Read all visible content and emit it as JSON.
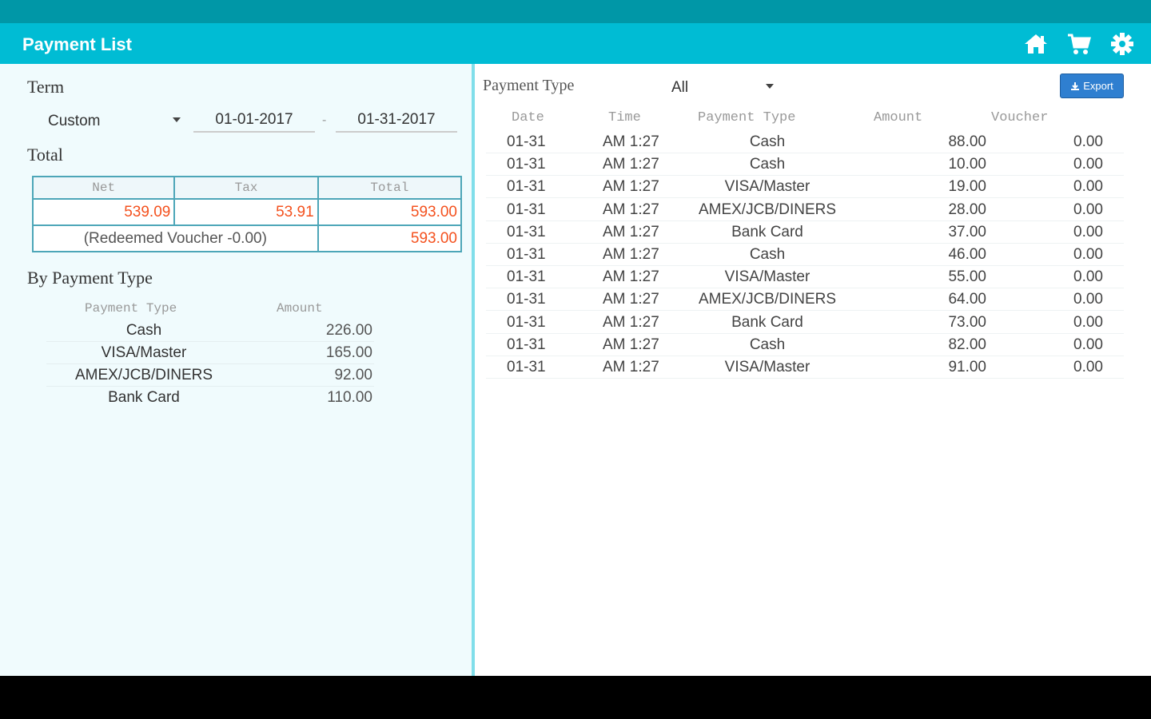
{
  "app_bar": {
    "title": "Payment List",
    "icons": [
      "home-icon",
      "cart-icon",
      "settings-icon"
    ],
    "color": "#00bcd4"
  },
  "left": {
    "term_title": "Term",
    "term_value": "Custom",
    "date_from": "01-01-2017",
    "date_sep": "-",
    "date_to": "01-31-2017",
    "total_title": "Total",
    "totals": {
      "headers": [
        "Net",
        "Tax",
        "Total"
      ],
      "net": "539.09",
      "tax": "53.91",
      "total": "593.00",
      "voucher_label": "(Redeemed Voucher -0.00)",
      "voucher_total": "593.00"
    },
    "by_type_title": "By Payment Type",
    "by_type_headers": [
      "Payment Type",
      "Amount"
    ],
    "by_type": [
      {
        "name": "Cash",
        "amount": "226.00"
      },
      {
        "name": "VISA/Master",
        "amount": "165.00"
      },
      {
        "name": "AMEX/JCB/DINERS",
        "amount": "92.00"
      },
      {
        "name": "Bank Card",
        "amount": "110.00"
      }
    ]
  },
  "right": {
    "filter_label": "Payment Type",
    "filter_value": "All",
    "export_label": "Export",
    "headers": [
      "Date",
      "Time",
      "Payment Type",
      "Amount",
      "Voucher"
    ],
    "rows": [
      {
        "date": "01-31",
        "time": "AM 1:27",
        "type": "Cash",
        "amount": "88.00",
        "voucher": "0.00"
      },
      {
        "date": "01-31",
        "time": "AM 1:27",
        "type": "Cash",
        "amount": "10.00",
        "voucher": "0.00"
      },
      {
        "date": "01-31",
        "time": "AM 1:27",
        "type": "VISA/Master",
        "amount": "19.00",
        "voucher": "0.00"
      },
      {
        "date": "01-31",
        "time": "AM 1:27",
        "type": "AMEX/JCB/DINERS",
        "amount": "28.00",
        "voucher": "0.00"
      },
      {
        "date": "01-31",
        "time": "AM 1:27",
        "type": "Bank Card",
        "amount": "37.00",
        "voucher": "0.00"
      },
      {
        "date": "01-31",
        "time": "AM 1:27",
        "type": "Cash",
        "amount": "46.00",
        "voucher": "0.00"
      },
      {
        "date": "01-31",
        "time": "AM 1:27",
        "type": "VISA/Master",
        "amount": "55.00",
        "voucher": "0.00"
      },
      {
        "date": "01-31",
        "time": "AM 1:27",
        "type": "AMEX/JCB/DINERS",
        "amount": "64.00",
        "voucher": "0.00"
      },
      {
        "date": "01-31",
        "time": "AM 1:27",
        "type": "Bank Card",
        "amount": "73.00",
        "voucher": "0.00"
      },
      {
        "date": "01-31",
        "time": "AM 1:27",
        "type": "Cash",
        "amount": "82.00",
        "voucher": "0.00"
      },
      {
        "date": "01-31",
        "time": "AM 1:27",
        "type": "VISA/Master",
        "amount": "91.00",
        "voucher": "0.00"
      }
    ]
  },
  "colors": {
    "accent": "#00bcd4",
    "status_bar": "#0097a7",
    "highlight_number": "#f4511e",
    "export_button": "#2f7fd0"
  }
}
